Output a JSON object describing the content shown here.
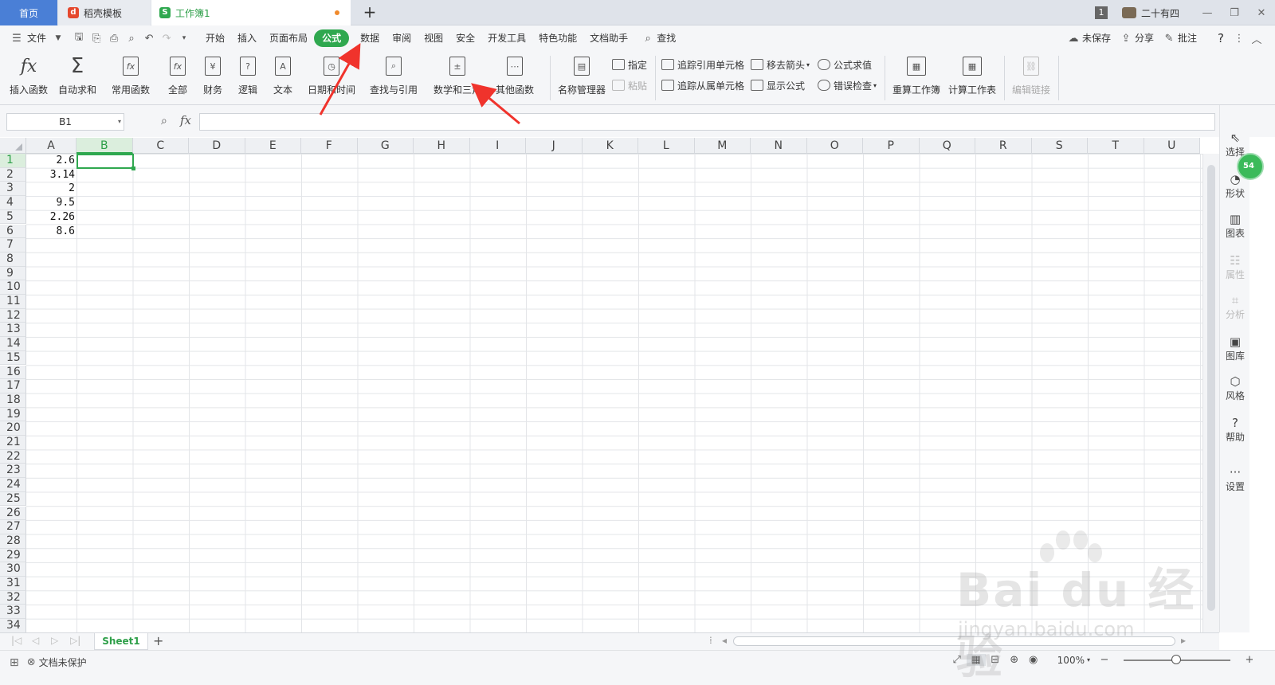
{
  "tabs": {
    "home": "首页",
    "template": "稻壳模板",
    "workbook": "工作簿1",
    "new": "+"
  },
  "window": {
    "badge": "1",
    "user": "二十有四"
  },
  "menu": {
    "file": "文件",
    "items": [
      "开始",
      "插入",
      "页面布局",
      "公式",
      "数据",
      "审阅",
      "视图",
      "安全",
      "开发工具",
      "特色功能",
      "文档助手"
    ],
    "active": "公式",
    "search": "查找",
    "unsaved": "未保存",
    "share": "分享",
    "comment": "批注",
    "help": "?"
  },
  "ribbon": {
    "insert_function": "插入函数",
    "autosum": "自动求和",
    "common": "常用函数",
    "all": "全部",
    "finance": "财务",
    "logic": "逻辑",
    "text": "文本",
    "datetime": "日期和时间",
    "lookup": "查找与引用",
    "math": "数学和三角",
    "other": "其他函数",
    "name_manager": "名称管理器",
    "specify": "指定",
    "paste": "粘贴",
    "trace_precedents": "追踪引用单元格",
    "trace_dependents": "追踪从属单元格",
    "remove_arrows": "移去箭头",
    "show_formulas": "显示公式",
    "evaluate": "公式求值",
    "error_check": "错误检查",
    "recalc_workbook": "重算工作簿",
    "calc_sheet": "计算工作表",
    "edit_links": "编辑链接"
  },
  "formula_bar": {
    "name_box": "B1",
    "fx": "fx",
    "value": ""
  },
  "grid": {
    "columns": [
      "A",
      "B",
      "C",
      "D",
      "E",
      "F",
      "G",
      "H",
      "I",
      "J",
      "K",
      "L",
      "M",
      "N",
      "O",
      "P",
      "Q",
      "R",
      "S",
      "T",
      "U"
    ],
    "selected_column": "B",
    "rows": 34,
    "selected_row": 1,
    "values": [
      "2.6",
      "3.14",
      "2",
      "9.5",
      "2.26",
      "8.6"
    ]
  },
  "sidebar": {
    "select": "选择",
    "shape": "形状",
    "chart": "图表",
    "property": "属性",
    "analysis": "分析",
    "gallery": "图库",
    "style": "风格",
    "help": "帮助",
    "settings": "设置",
    "badge": "54"
  },
  "sheets": {
    "tab": "Sheet1",
    "add": "+"
  },
  "status": {
    "protect": "文档未保护",
    "zoom": "100%"
  },
  "watermark": {
    "brand": "Bai du 经验",
    "url": "jingyan.baidu.com"
  },
  "colors": {
    "accent": "#2fa84f",
    "annotation": "#f0332c",
    "home_tab": "#4a7fd6"
  }
}
